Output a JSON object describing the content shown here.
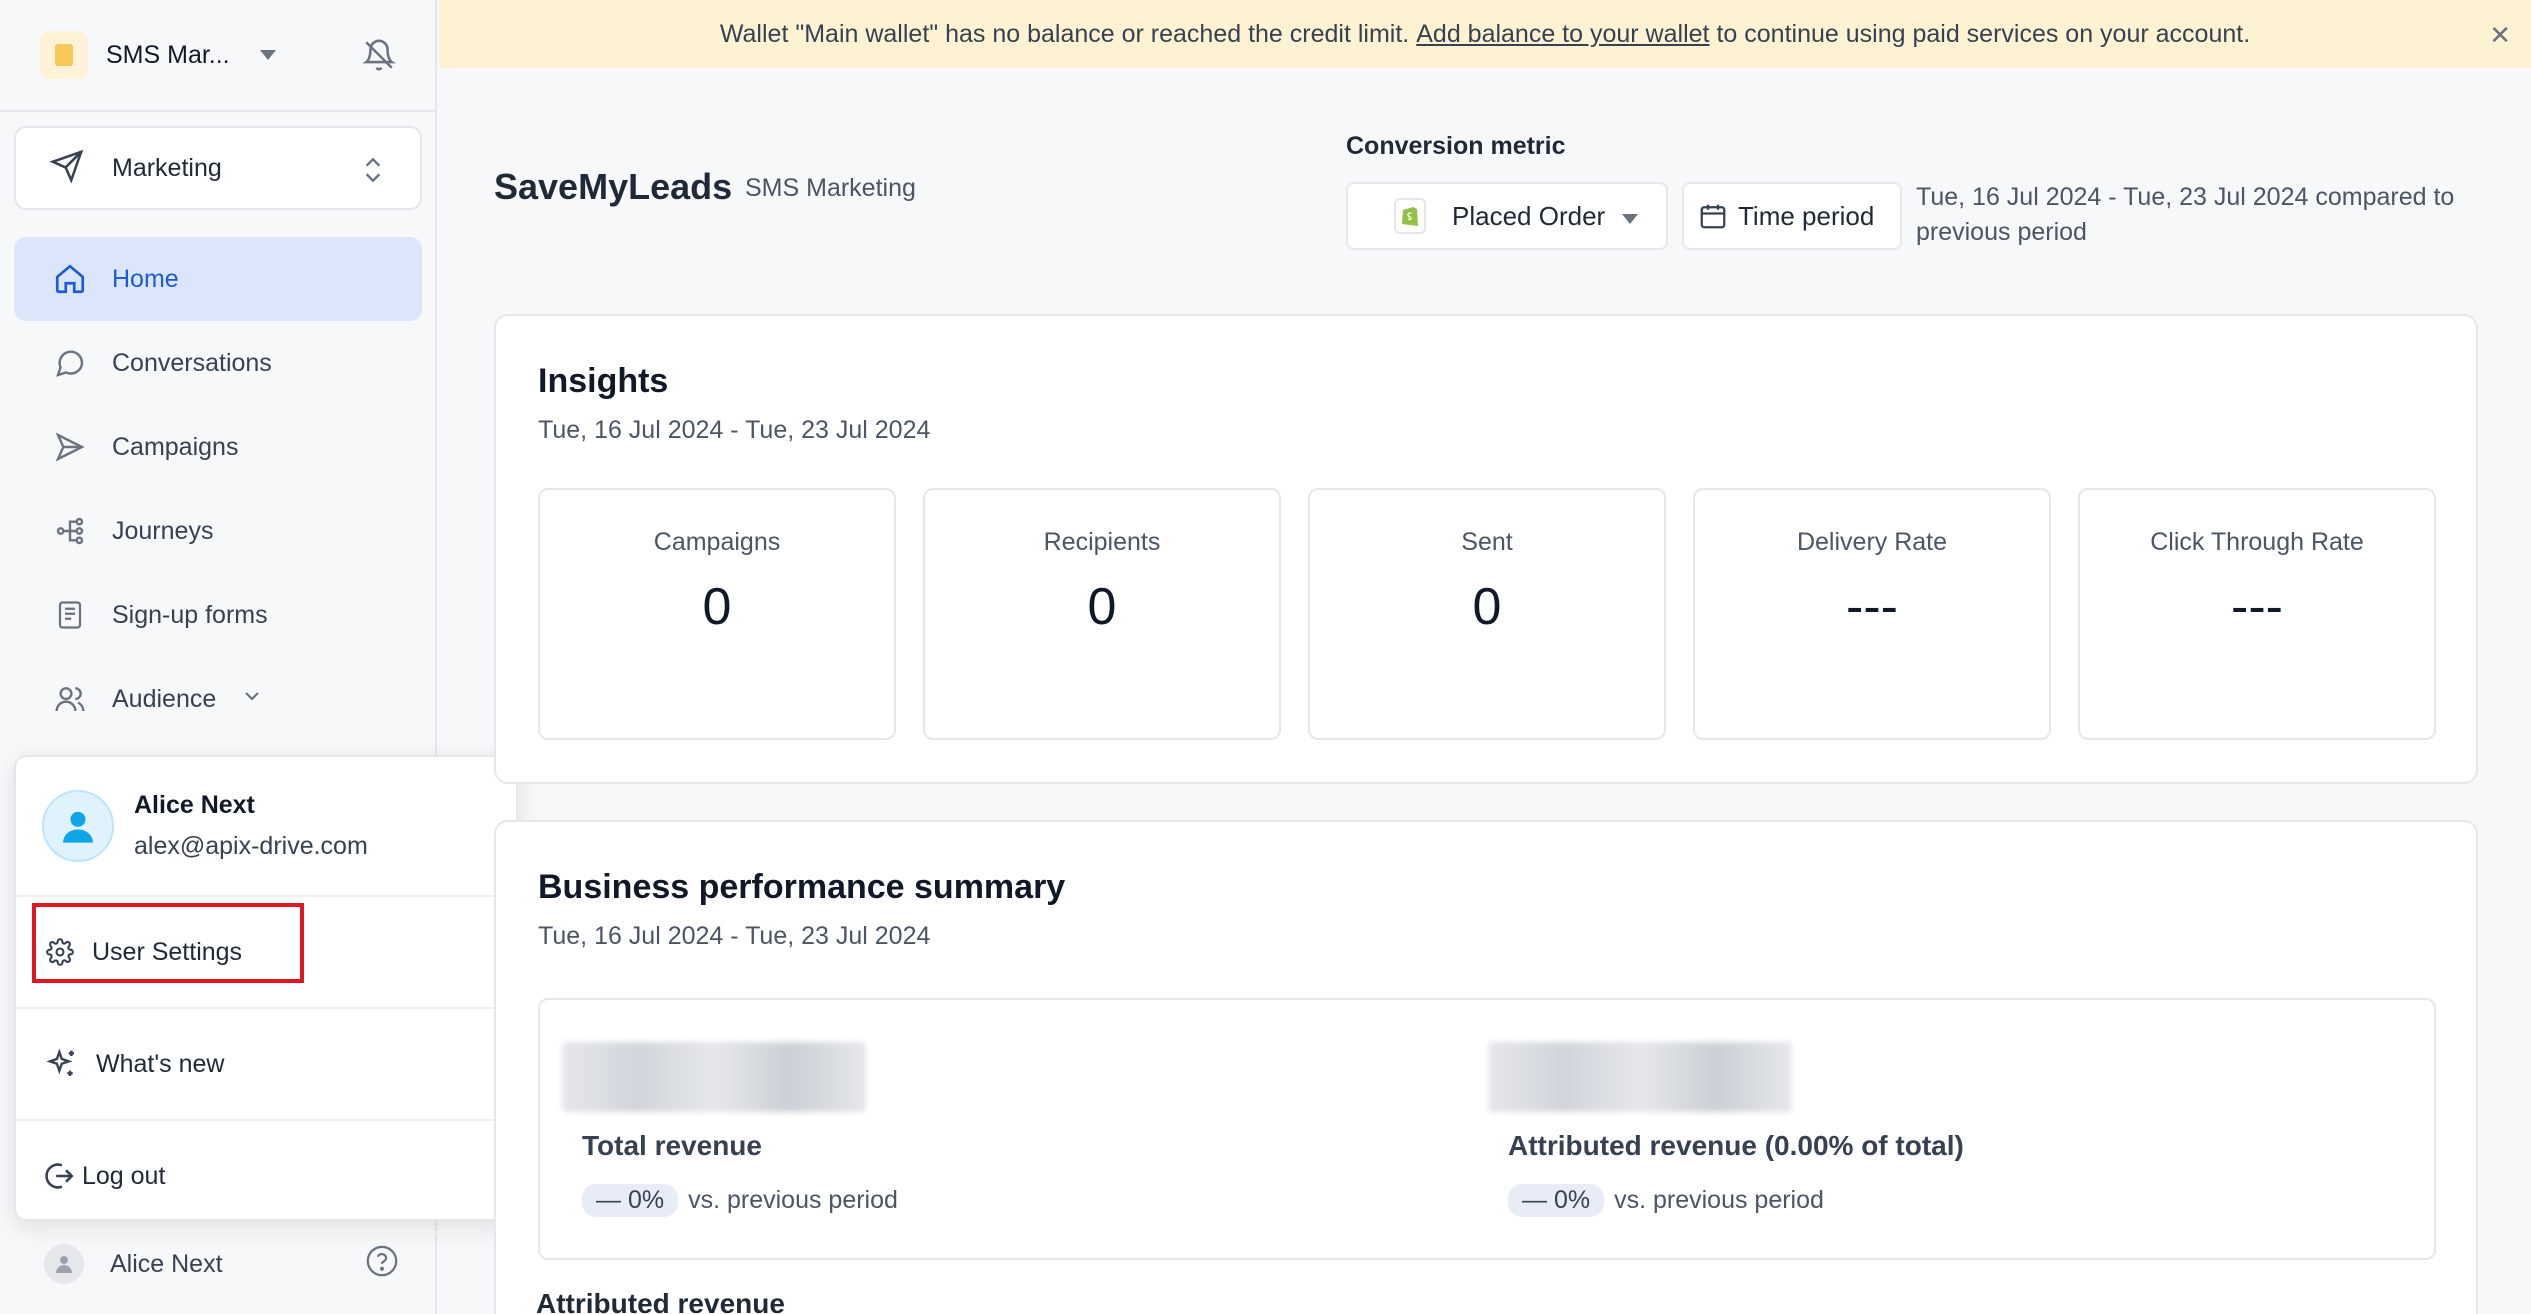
{
  "sidebar": {
    "workspace_name": "SMS Mar...",
    "switcher_label": "Marketing",
    "nav": [
      {
        "label": "Home",
        "icon": "home-icon",
        "active": true
      },
      {
        "label": "Conversations",
        "icon": "chat-icon"
      },
      {
        "label": "Campaigns",
        "icon": "send-icon"
      },
      {
        "label": "Journeys",
        "icon": "flow-icon"
      },
      {
        "label": "Sign-up forms",
        "icon": "form-icon"
      },
      {
        "label": "Audience",
        "icon": "users-icon"
      }
    ],
    "footer_user": "Alice Next"
  },
  "popup": {
    "name": "Alice Next",
    "email": "alex@apix-drive.com",
    "items": [
      {
        "label": "User Settings",
        "icon": "gear-icon"
      },
      {
        "label": "What's new",
        "icon": "sparkle-icon"
      },
      {
        "label": "Log out",
        "icon": "logout-icon"
      }
    ]
  },
  "banner": {
    "text_before": "Wallet \"Main wallet\" has no balance or reached the credit limit.",
    "link": "Add balance to your wallet",
    "text_after": "to continue using paid services on your account."
  },
  "header": {
    "title": "SaveMyLeads",
    "subtitle": "SMS Marketing",
    "conversion_label": "Conversion metric",
    "conversion_value": "Placed Order",
    "time_period_label": "Time period",
    "date_range": "Tue, 16 Jul 2024 - Tue, 23 Jul 2024 compared to previous period"
  },
  "insights": {
    "title": "Insights",
    "date": "Tue, 16 Jul 2024 - Tue, 23 Jul 2024",
    "metrics": [
      {
        "label": "Campaigns",
        "value": "0"
      },
      {
        "label": "Recipients",
        "value": "0"
      },
      {
        "label": "Sent",
        "value": "0"
      },
      {
        "label": "Delivery Rate",
        "value": "---"
      },
      {
        "label": "Click Through Rate",
        "value": "---"
      }
    ]
  },
  "performance": {
    "title": "Business performance summary",
    "date": "Tue, 16 Jul 2024 - Tue, 23 Jul 2024",
    "total_label": "Total revenue",
    "total_change": "— 0%",
    "attributed_label": "Attributed revenue (0.00% of total)",
    "attributed_change": "— 0%",
    "vs_text": "vs. previous period",
    "next_section": "Attributed revenue"
  },
  "colors": {
    "accent": "#1e5bd6",
    "active_bg": "#dbe6fb",
    "banner_bg": "#fdf3d3",
    "highlight": "#e0171d"
  }
}
